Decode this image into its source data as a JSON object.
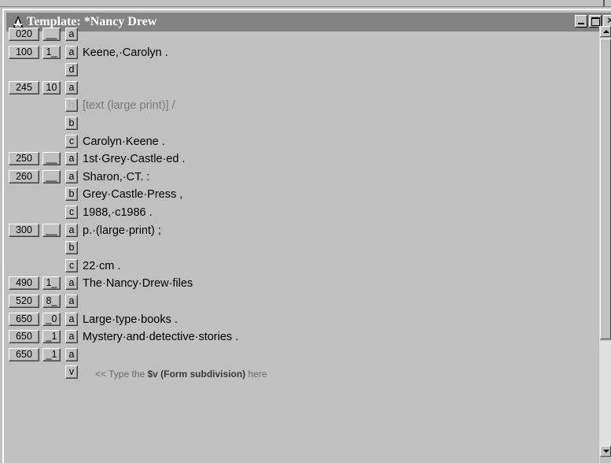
{
  "window": {
    "title": "Template: *Nancy Drew",
    "colors": {
      "titlebar": "#838383",
      "face": "#c0c0c0"
    }
  },
  "rows": [
    {
      "tag": "020",
      "ind": "__",
      "sub": "a",
      "value": ""
    },
    {
      "tag": "100",
      "ind": "1_",
      "sub": "a",
      "value": "Keene,·Carolyn ."
    },
    {
      "tag": "",
      "ind": "",
      "sub": "d",
      "value": ""
    },
    {
      "tag": "245",
      "ind": "10",
      "sub": "a",
      "value": ""
    },
    {
      "tag": "",
      "ind": "",
      "sub": "h",
      "value": "[text (large print)]  /",
      "dim": true
    },
    {
      "tag": "",
      "ind": "",
      "sub": "b",
      "value": ""
    },
    {
      "tag": "",
      "ind": "",
      "sub": "c",
      "value": "Carolyn·Keene ."
    },
    {
      "tag": "250",
      "ind": "__",
      "sub": "a",
      "value": "1st·Grey·Castle·ed ."
    },
    {
      "tag": "260",
      "ind": "__",
      "sub": "a",
      "value": "Sharon,·CT.  :"
    },
    {
      "tag": "",
      "ind": "",
      "sub": "b",
      "value": "Grey·Castle·Press ,"
    },
    {
      "tag": "",
      "ind": "",
      "sub": "c",
      "value": "1988,·c1986 ."
    },
    {
      "tag": "300",
      "ind": "__",
      "sub": "a",
      "value": "p.·(large·print)  ;"
    },
    {
      "tag": "",
      "ind": "",
      "sub": "b",
      "value": ""
    },
    {
      "tag": "",
      "ind": "",
      "sub": "c",
      "value": "22·cm ."
    },
    {
      "tag": "490",
      "ind": "1_",
      "sub": "a",
      "value": "The·Nancy·Drew·files"
    },
    {
      "tag": "520",
      "ind": "8_",
      "sub": "a",
      "value": ""
    },
    {
      "tag": "650",
      "ind": "_0",
      "sub": "a",
      "value": "Large·type·books ."
    },
    {
      "tag": "650",
      "ind": "_1",
      "sub": "a",
      "value": "Mystery·and·detective·stories ."
    },
    {
      "tag": "650",
      "ind": "_1",
      "sub": "a",
      "value": ""
    },
    {
      "tag": "",
      "ind": "",
      "sub": "v",
      "value": ""
    }
  ],
  "hint": {
    "prefix": "<< Type the ",
    "code": "$v (Form subdivision)",
    "suffix": " here"
  }
}
